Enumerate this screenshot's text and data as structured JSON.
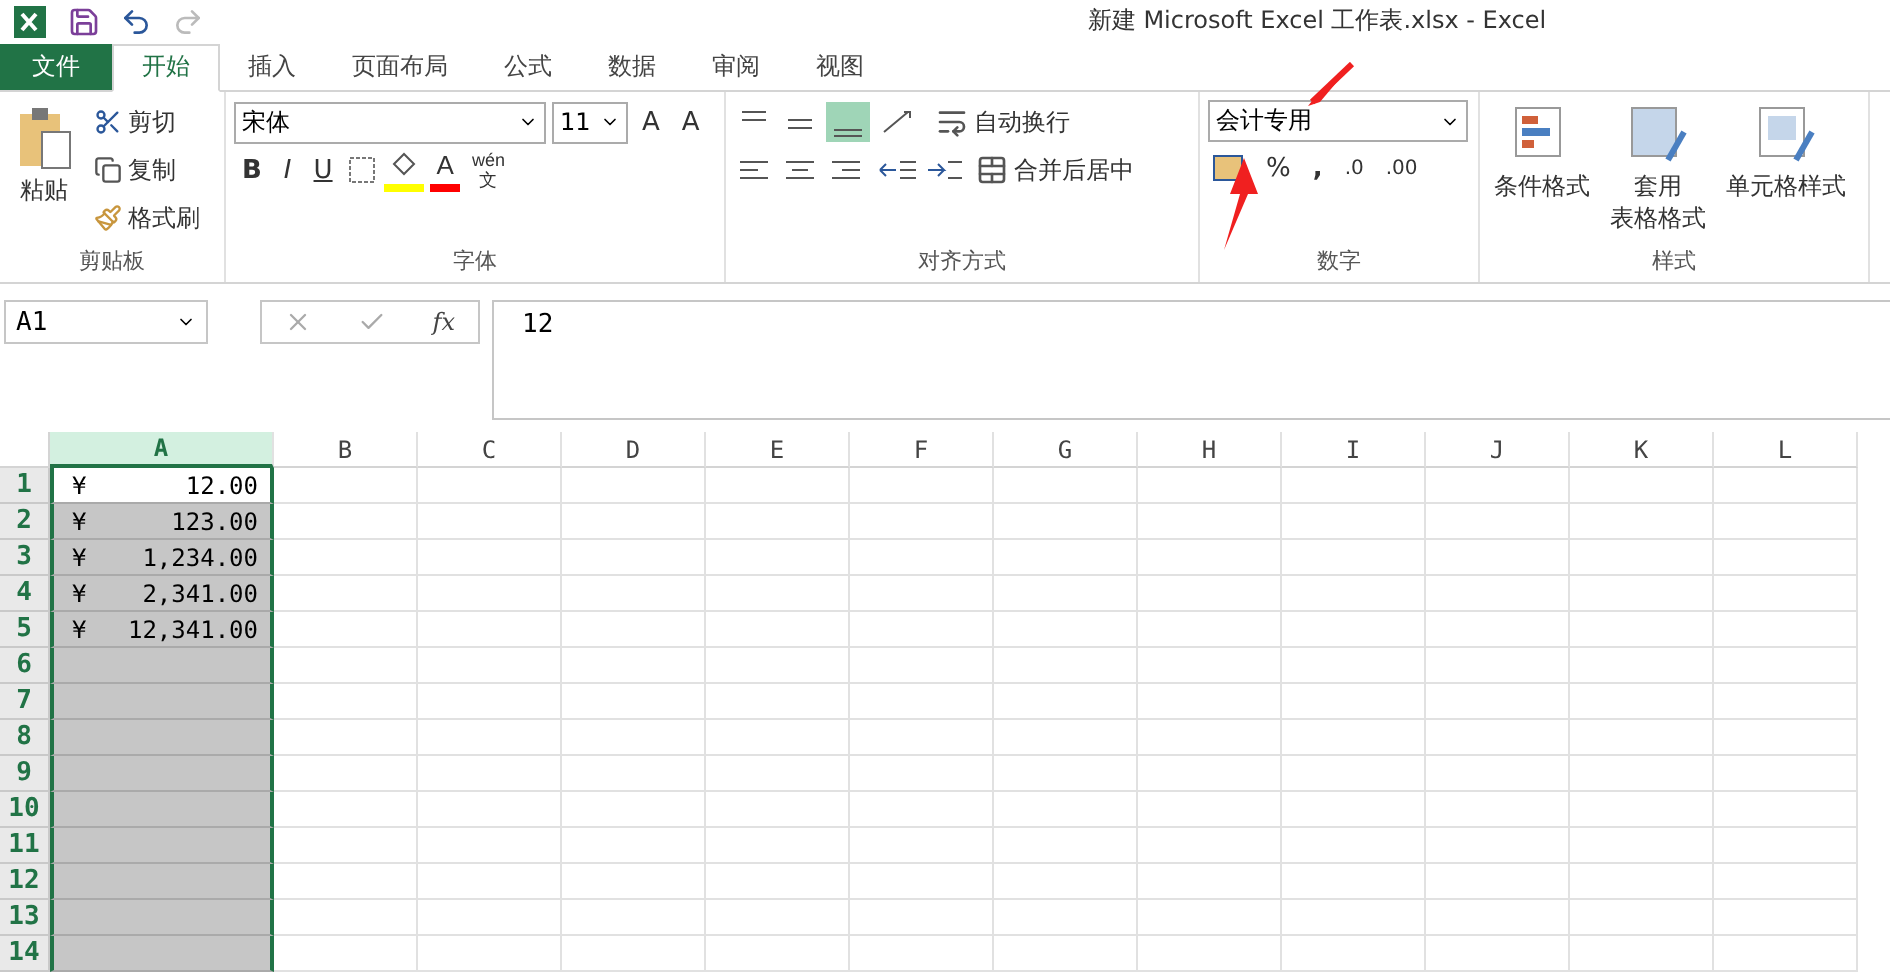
{
  "window": {
    "title": "新建 Microsoft Excel 工作表.xlsx - Excel"
  },
  "tabs": [
    {
      "label": "文件",
      "kind": "file",
      "selected": false
    },
    {
      "label": "开始",
      "kind": "tab",
      "selected": true
    },
    {
      "label": "插入",
      "kind": "tab",
      "selected": false
    },
    {
      "label": "页面布局",
      "kind": "tab",
      "selected": false
    },
    {
      "label": "公式",
      "kind": "tab",
      "selected": false
    },
    {
      "label": "数据",
      "kind": "tab",
      "selected": false
    },
    {
      "label": "审阅",
      "kind": "tab",
      "selected": false
    },
    {
      "label": "视图",
      "kind": "tab",
      "selected": false
    }
  ],
  "clipboard": {
    "paste": "粘贴",
    "cut": "剪切",
    "copy": "复制",
    "format_painter": "格式刷",
    "label": "剪贴板"
  },
  "font": {
    "name": "宋体",
    "size": "11",
    "grow": "A",
    "shrink": "A",
    "bold": "B",
    "italic": "I",
    "underline": "U",
    "font_color": "A",
    "phonetic_top": "wén",
    "phonetic_bottom": "文",
    "label": "字体"
  },
  "alignment": {
    "wrap": "自动换行",
    "merge": "合并后居中",
    "label": "对齐方式"
  },
  "number": {
    "format": "会计专用",
    "percent": "%",
    "comma": ",",
    "increase_decimal": ".0",
    "decrease_decimal": ".00",
    "label": "数字"
  },
  "styles": {
    "conditional": "条件格式",
    "table_line1": "套用",
    "table_line2": "表格格式",
    "cell_styles": "单元格样式",
    "label": "样式"
  },
  "formula_bar": {
    "name_box": "A1",
    "fx": "fx",
    "value": "12"
  },
  "sheet": {
    "columns": [
      {
        "label": "A",
        "selected": true
      },
      {
        "label": "B",
        "selected": false
      },
      {
        "label": "C",
        "selected": false
      },
      {
        "label": "D",
        "selected": false
      },
      {
        "label": "E",
        "selected": false
      },
      {
        "label": "F",
        "selected": false
      },
      {
        "label": "G",
        "selected": false
      },
      {
        "label": "H",
        "selected": false
      },
      {
        "label": "I",
        "selected": false
      },
      {
        "label": "J",
        "selected": false
      },
      {
        "label": "K",
        "selected": false
      },
      {
        "label": "L",
        "selected": false
      }
    ],
    "rows": [
      {
        "label": "1",
        "active": true,
        "symbol": "¥",
        "amount": "12.00"
      },
      {
        "label": "2",
        "active": false,
        "symbol": "¥",
        "amount": "123.00"
      },
      {
        "label": "3",
        "active": false,
        "symbol": "¥",
        "amount": "1,234.00"
      },
      {
        "label": "4",
        "active": false,
        "symbol": "¥",
        "amount": "2,341.00"
      },
      {
        "label": "5",
        "active": false,
        "symbol": "¥",
        "amount": "12,341.00"
      },
      {
        "label": "6",
        "active": false
      },
      {
        "label": "7",
        "active": false
      },
      {
        "label": "8",
        "active": false
      },
      {
        "label": "9",
        "active": false
      },
      {
        "label": "10",
        "active": false
      },
      {
        "label": "11",
        "active": false
      },
      {
        "label": "12",
        "active": false
      },
      {
        "label": "13",
        "active": false
      },
      {
        "label": "14",
        "active": false
      }
    ]
  }
}
